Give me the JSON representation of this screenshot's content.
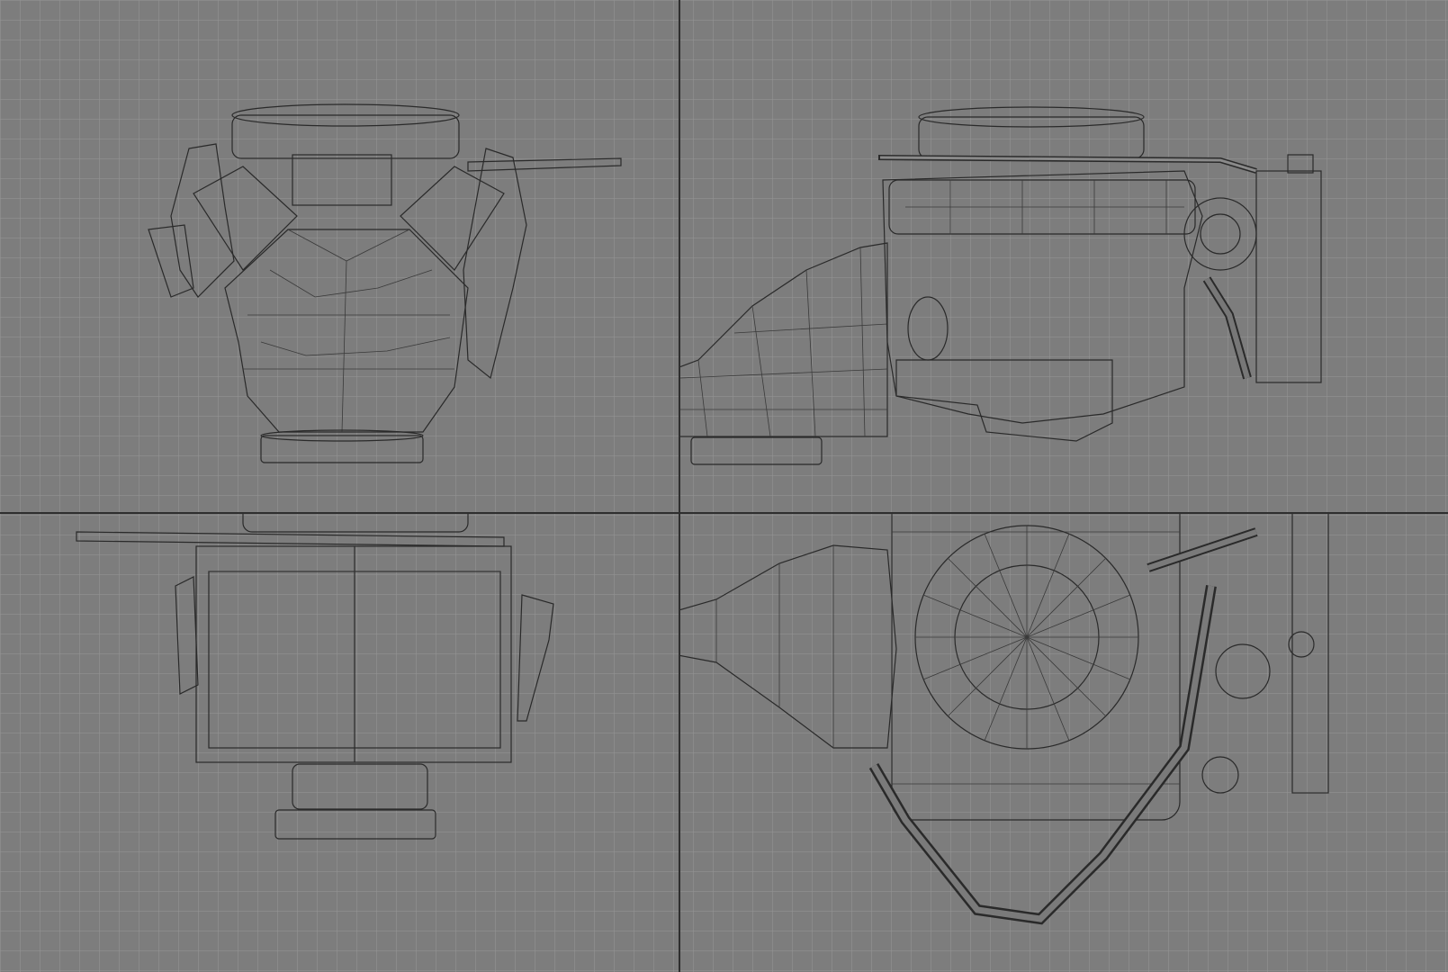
{
  "colors": {
    "background": "#7d7d7d",
    "grid_line": "#969696",
    "viewport_divider": "#2e2e2e",
    "mesh_fill": "#6a6a6a",
    "mesh_wire": "#2a2a2a"
  },
  "viewports": [
    {
      "id": "front",
      "icon": "engine-front-view-icon"
    },
    {
      "id": "side",
      "icon": "engine-side-view-icon"
    },
    {
      "id": "rear",
      "icon": "engine-rear-view-icon"
    },
    {
      "id": "top",
      "icon": "engine-top-view-icon"
    }
  ]
}
